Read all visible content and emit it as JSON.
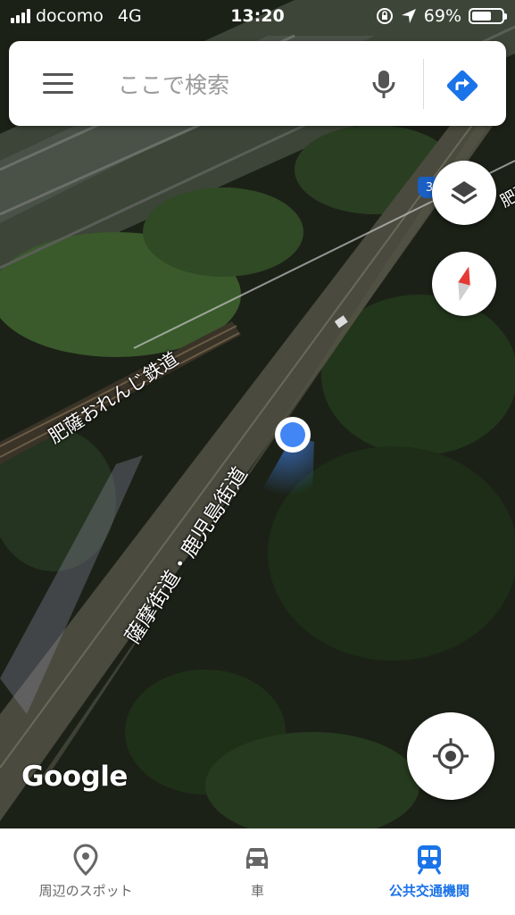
{
  "status_bar": {
    "carrier": "docomo",
    "network": "4G",
    "time": "13:20",
    "battery": "69%",
    "battery_level": 0.69
  },
  "search": {
    "placeholder": "ここで検索"
  },
  "map": {
    "road_main_label": "薩摩街道・鹿児島街道",
    "railway_label": "肥薩おれんじ鉄道",
    "edge_label": "肥薩",
    "route_shield": "3",
    "attribution": "Google"
  },
  "bottom_nav": {
    "tabs": [
      {
        "label": "周辺のスポット",
        "icon": "place-pin-icon",
        "active": false
      },
      {
        "label": "車",
        "icon": "car-icon",
        "active": false
      },
      {
        "label": "公共交通機関",
        "icon": "train-icon",
        "active": true
      }
    ]
  },
  "colors": {
    "accent": "#1a73e8",
    "location_dot": "#4285f4",
    "direction_button": "#1a73e8",
    "compass_red": "#e53935"
  }
}
